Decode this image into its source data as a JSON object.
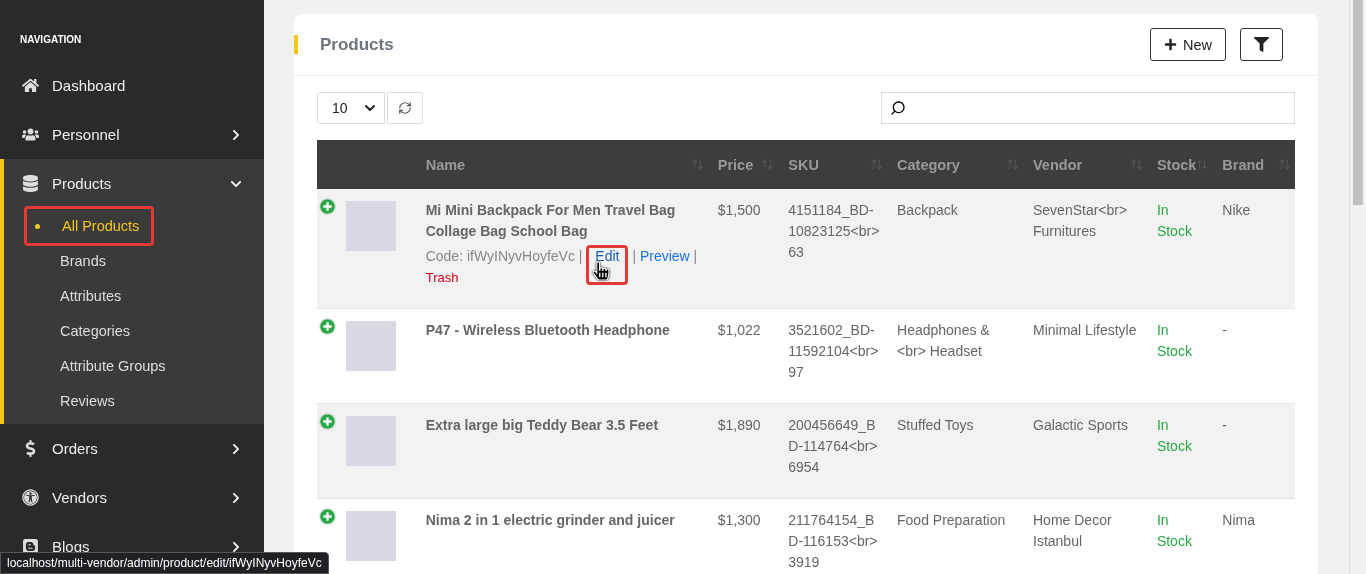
{
  "sidebar": {
    "heading": "NAVIGATION",
    "items": [
      {
        "label": "Dashboard",
        "has_submenu": false,
        "expanded": false
      },
      {
        "label": "Personnel",
        "has_submenu": true,
        "expanded": false
      },
      {
        "label": "Products",
        "has_submenu": true,
        "expanded": true,
        "children": [
          {
            "label": "All Products",
            "selected": true,
            "highlighted": true
          },
          {
            "label": "Brands",
            "selected": false,
            "highlighted": false
          },
          {
            "label": "Attributes",
            "selected": false,
            "highlighted": false
          },
          {
            "label": "Categories",
            "selected": false,
            "highlighted": false
          },
          {
            "label": "Attribute Groups",
            "selected": false,
            "highlighted": false
          },
          {
            "label": "Reviews",
            "selected": false,
            "highlighted": false
          }
        ]
      },
      {
        "label": "Orders",
        "has_submenu": true,
        "expanded": false
      },
      {
        "label": "Vendors",
        "has_submenu": true,
        "expanded": false
      },
      {
        "label": "Blogs",
        "has_submenu": true,
        "expanded": false
      }
    ]
  },
  "card": {
    "title": "Products",
    "new_button": "New",
    "page_size": "10"
  },
  "table": {
    "columns": [
      "Name",
      "Price",
      "SKU",
      "Category",
      "Vendor",
      "Stock",
      "Brand"
    ],
    "rows": [
      {
        "name": "Mi Mini Backpack For Men Travel Bag Collage Bag School Bag",
        "code": "Code: ifWyINyvHoyfeVc",
        "actions": [
          {
            "label": "|",
            "kind": "separator"
          },
          {
            "label": "Edit",
            "kind": "edit",
            "highlighted": true
          },
          {
            "label": "|",
            "kind": "separator"
          },
          {
            "label": "Preview",
            "kind": "preview",
            "highlighted": false
          },
          {
            "label": "|",
            "kind": "separator"
          },
          {
            "label": "Trash",
            "kind": "trash",
            "highlighted": false
          }
        ],
        "price": "$1,500",
        "sku": "4151184_BD-10823125<br>63",
        "category": "Backpack",
        "vendor": "SevenStar<br> Furnitures",
        "stock": "In Stock",
        "brand": "Nike"
      },
      {
        "name": "P47 - Wireless Bluetooth Headphone",
        "price": "$1,022",
        "sku": "3521602_BD-11592104<br>97",
        "category": "Headphones & <br> Headset",
        "vendor": "Minimal Lifestyle",
        "stock": "In Stock",
        "brand": "-"
      },
      {
        "name": "Extra large big Teddy Bear 3.5 Feet",
        "price": "$1,890",
        "sku": "200456649_BD-114764<br>6954",
        "category": "Stuffed Toys",
        "vendor": "Galactic Sports",
        "stock": "In Stock",
        "brand": "-"
      },
      {
        "name": "Nima 2 in 1 electric grinder and juicer",
        "price": "$1,300",
        "sku": "211764154_BD-116153<br>3919",
        "category": "Food Preparation",
        "vendor": "Home Decor Istanbul",
        "stock": "In Stock",
        "brand": "Nima"
      }
    ]
  },
  "status_url": "localhost/multi-vendor/admin/product/edit/ifWyINyvHoyfeVc"
}
